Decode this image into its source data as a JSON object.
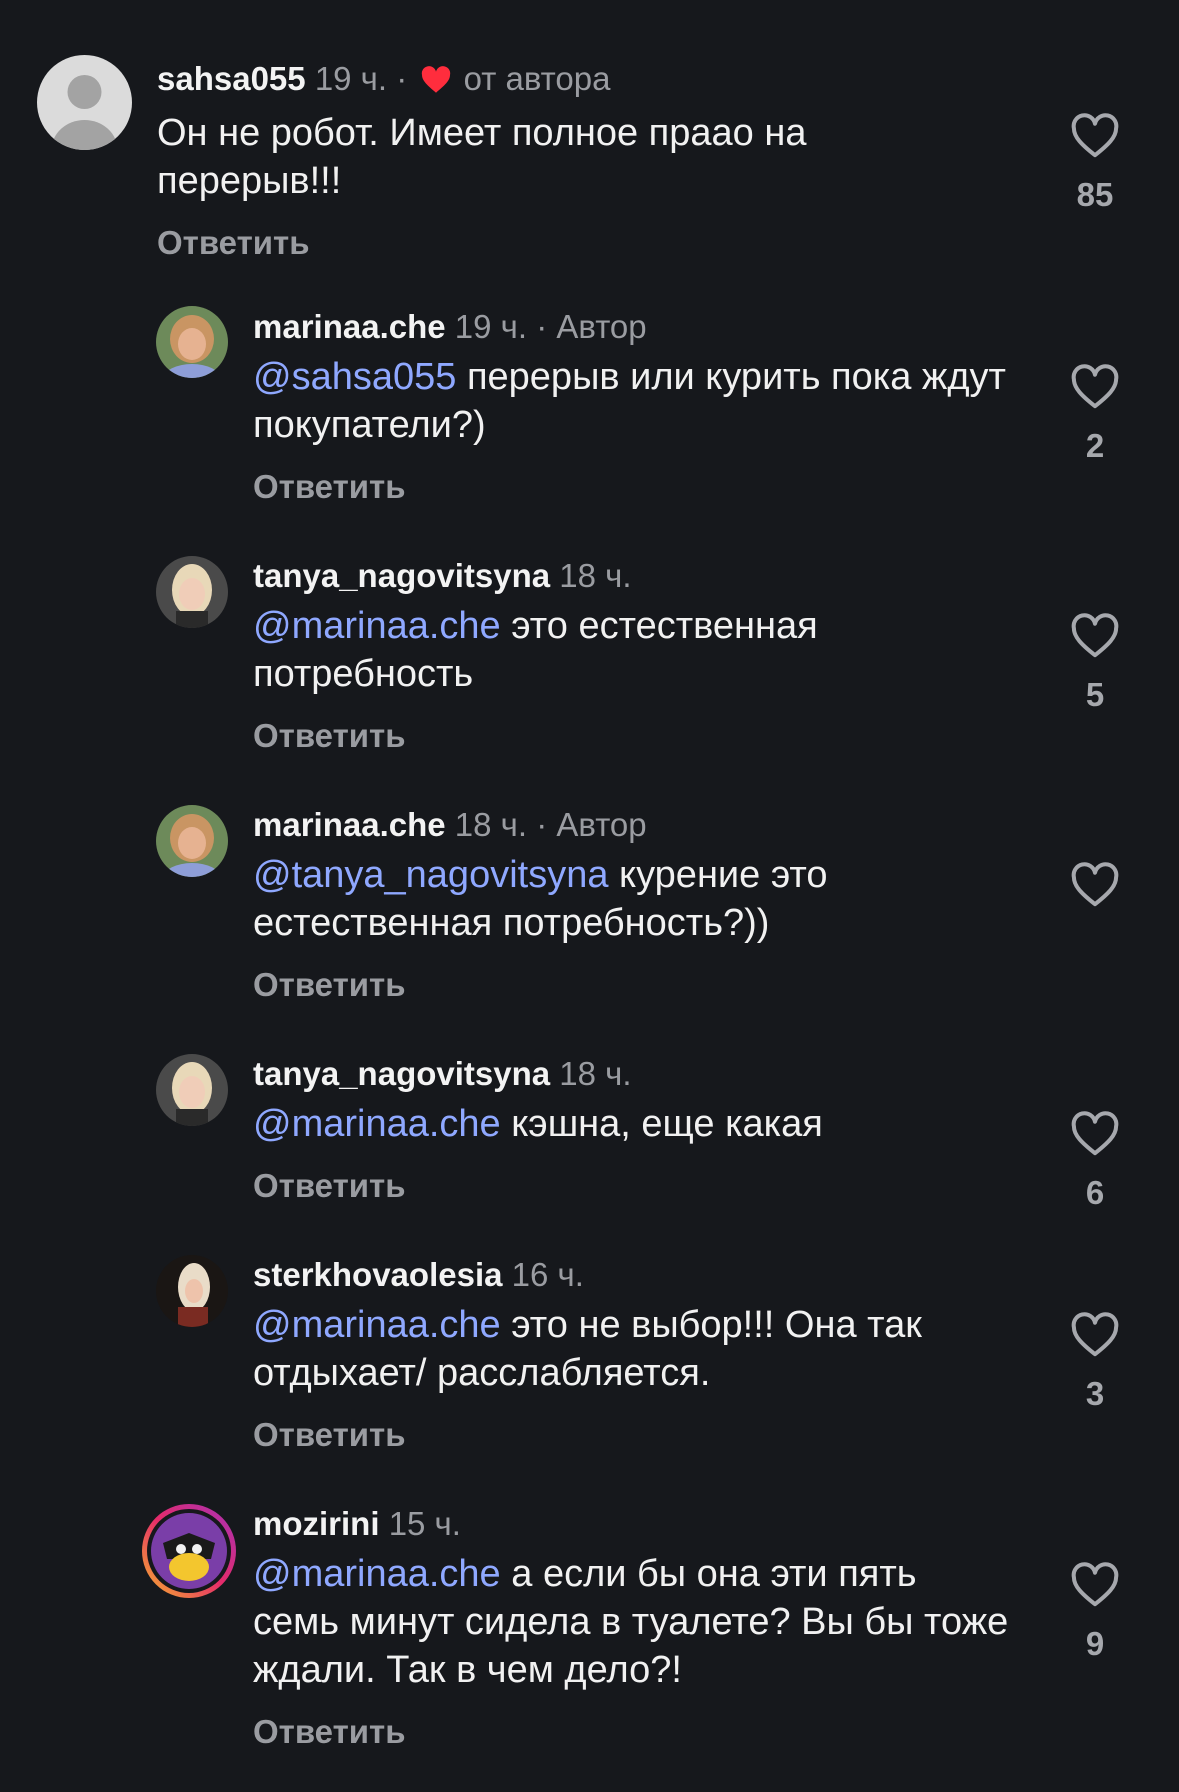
{
  "reply_label": "Ответить",
  "comments": [
    {
      "username": "sahsa055",
      "time": "19 ч.",
      "separator": "·",
      "liked_by": "от автора",
      "author_tag": "",
      "mention": "",
      "text": "Он не робот. Имеет полное праао на перерыв!!!",
      "likes": "85"
    },
    {
      "username": "marinaa.che",
      "time": "19 ч.",
      "separator": "·",
      "liked_by": "",
      "author_tag": "Автор",
      "mention": "@sahsa055",
      "text": "перерыв или курить пока ждут покупатели?)",
      "likes": "2"
    },
    {
      "username": "tanya_nagovitsyna",
      "time": "18 ч.",
      "separator": "",
      "liked_by": "",
      "author_tag": "",
      "mention": "@marinaa.che",
      "text": "это естественная потребность",
      "likes": "5"
    },
    {
      "username": "marinaa.che",
      "time": "18 ч.",
      "separator": "·",
      "liked_by": "",
      "author_tag": "Автор",
      "mention": "@tanya_nagovitsyna",
      "text": "курение это естественная потребность?))",
      "likes": ""
    },
    {
      "username": "tanya_nagovitsyna",
      "time": "18 ч.",
      "separator": "",
      "liked_by": "",
      "author_tag": "",
      "mention": "@marinaa.che",
      "text": "кэшна, еще какая",
      "likes": "6"
    },
    {
      "username": "sterkhovaolesia",
      "time": "16 ч.",
      "separator": "",
      "liked_by": "",
      "author_tag": "",
      "mention": "@marinaa.che",
      "text": "это не выбор!!! Она так отдыхает/ расслабляется.",
      "likes": "3"
    },
    {
      "username": "mozirini",
      "time": "15 ч.",
      "separator": "",
      "liked_by": "",
      "author_tag": "",
      "mention": "@marinaa.che",
      "text": "а если бы она эти пять семь минут сидела в туалете? Вы бы тоже ждали. Так в чем дело?!",
      "likes": "9"
    }
  ],
  "colors": {
    "background": "#16181c",
    "mention": "#8fa8ff",
    "author_heart": "#ff2d3d",
    "muted": "#9a9ca1"
  },
  "icons": {
    "like": "heart-outline-icon",
    "liked_by_author": "heart-filled-icon",
    "default_avatar": "default-avatar-icon"
  }
}
